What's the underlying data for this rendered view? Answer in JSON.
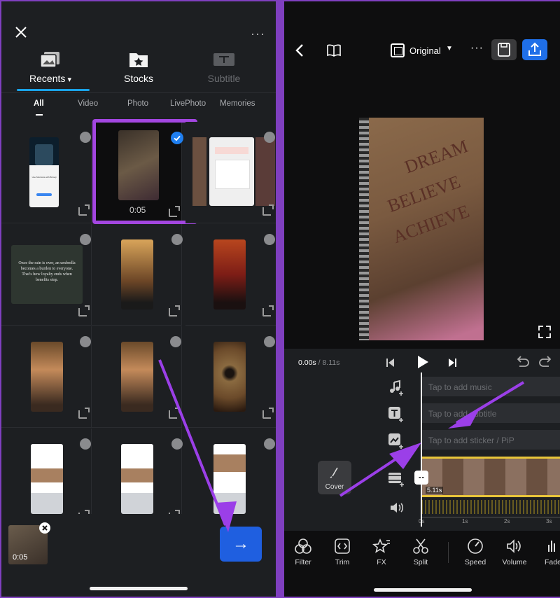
{
  "left": {
    "tabs": [
      {
        "label": "Recents",
        "icon": "photos-icon",
        "active": true
      },
      {
        "label": "Stocks",
        "icon": "star-folder-icon",
        "active": false
      },
      {
        "label": "Subtitle",
        "icon": "subtitle-icon",
        "active": false
      }
    ],
    "filters": [
      "All",
      "Video",
      "Photo",
      "LivePhoto",
      "Memories"
    ],
    "selected_duration": "0:05",
    "cell_texts": {
      "quote": "Once the rain is over, an umbrella becomes a burden to everyone. That's how loyalty ends when benefits stop.",
      "phone_caption": "Use Shortcuts with Bitmoji"
    },
    "tray_duration": "0:05",
    "next_arrow": "→"
  },
  "right": {
    "aspect_label": "Original",
    "time_current": "0.00s",
    "time_total": "8.11s",
    "time_sep": " / ",
    "tracks": {
      "music": "Tap to add music",
      "subtitle": "Tap to add subtitle",
      "sticker": "Tap to add sticker / PiP"
    },
    "cover_label": "Cover",
    "clip_duration": "5.11s",
    "ruler": [
      "0s",
      "1s",
      "2s",
      "3s"
    ],
    "tools": [
      "Filter",
      "Trim",
      "FX",
      "Split",
      "Speed",
      "Volume",
      "Fade"
    ],
    "notebook_text": [
      "DREAM",
      "BELIEVE",
      "ACHIEVE"
    ]
  },
  "colors": {
    "accent_purple": "#8e3fe0",
    "accent_blue": "#1f6fe8",
    "clip_yellow": "#e8c53a"
  }
}
